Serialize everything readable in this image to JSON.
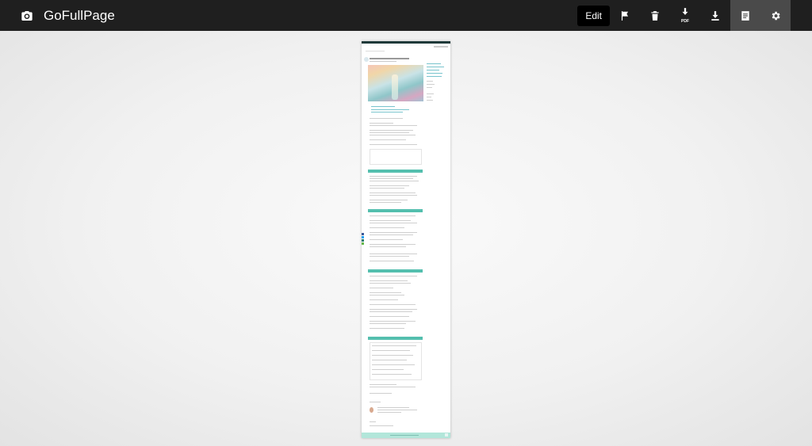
{
  "app": {
    "name": "GoFullPage"
  },
  "toolbar": {
    "edit_label": "Edit",
    "pdf_label": "PDF",
    "icons": {
      "camera": "camera-icon",
      "flag": "flag-icon",
      "trash": "trash-icon",
      "download_pdf": "download-pdf-icon",
      "download": "download-icon",
      "document": "document-icon",
      "settings": "gear-icon"
    },
    "active_button": "document"
  },
  "colors": {
    "toolbar_bg": "#1f1f1f",
    "active_button_bg": "#4a4a4a",
    "edit_button_bg": "#000000",
    "preview_accent": "#54bfae",
    "preview_footer": "#b2e6da"
  }
}
